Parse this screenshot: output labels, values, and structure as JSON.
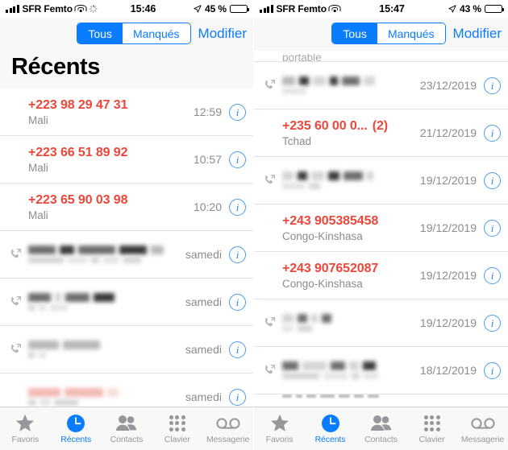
{
  "screens": [
    {
      "status": {
        "carrier": "SFR Femto",
        "time": "15:46",
        "battery_pct": "45 %",
        "signal_icon": "cellular-bars-icon",
        "wifi_icon": "wifi-icon",
        "activity_icon": "activity-spinner-icon",
        "location_icon": "location-arrow-icon",
        "battery_icon": "battery-icon",
        "battery_fill": 45
      },
      "nav": {
        "segments": [
          {
            "label": "Tous",
            "active": true
          },
          {
            "label": "Manqués",
            "active": false
          }
        ],
        "edit_label": "Modifier"
      },
      "title": "Récents",
      "rows": [
        {
          "kind": "text",
          "title": "+223 98 29 47 31",
          "count": "",
          "sub": "Mali",
          "time": "12:59",
          "icon": "",
          "missed": true
        },
        {
          "kind": "text",
          "title": "+223 66 51 89 92",
          "count": "",
          "sub": "Mali",
          "time": "10:57",
          "icon": "",
          "missed": true
        },
        {
          "kind": "text",
          "title": "+223 65 90 03 98",
          "count": "",
          "sub": "Mali",
          "time": "10:20",
          "icon": "",
          "missed": true
        },
        {
          "kind": "redacted",
          "time": "samedi",
          "icon": "outgoing-call-icon",
          "blur_style": "wide"
        },
        {
          "kind": "redacted",
          "time": "samedi",
          "icon": "outgoing-call-icon",
          "blur_style": "medium"
        },
        {
          "kind": "redacted",
          "time": "samedi",
          "icon": "outgoing-call-icon",
          "blur_style": "short"
        },
        {
          "kind": "redacted",
          "time": "samedi",
          "icon": "",
          "blur_style": "pink"
        }
      ]
    },
    {
      "status": {
        "carrier": "SFR Femto",
        "time": "15:47",
        "battery_pct": "43 %",
        "signal_icon": "cellular-bars-icon",
        "wifi_icon": "wifi-icon",
        "activity_icon": "",
        "location_icon": "location-arrow-icon",
        "battery_icon": "battery-icon",
        "battery_fill": 43
      },
      "nav": {
        "segments": [
          {
            "label": "Tous",
            "active": true
          },
          {
            "label": "Manqués",
            "active": false
          }
        ],
        "edit_label": "Modifier"
      },
      "title": "",
      "cut_top_label": "portable",
      "rows": [
        {
          "kind": "redacted",
          "time": "23/12/2019",
          "icon": "outgoing-call-icon",
          "blur_style": "medium"
        },
        {
          "kind": "text",
          "title": "+235 60 00 0...",
          "count": "(2)",
          "sub": "Tchad",
          "time": "21/12/2019",
          "icon": "",
          "missed": true
        },
        {
          "kind": "redacted",
          "time": "19/12/2019",
          "icon": "outgoing-call-icon",
          "blur_style": "medium"
        },
        {
          "kind": "text",
          "title": "+243 905385458",
          "count": "",
          "sub": "Congo-Kinshasa",
          "time": "19/12/2019",
          "icon": "",
          "missed": true
        },
        {
          "kind": "text",
          "title": "+243 907652087",
          "count": "",
          "sub": "Congo-Kinshasa",
          "time": "19/12/2019",
          "icon": "",
          "missed": true
        },
        {
          "kind": "redacted",
          "time": "19/12/2019",
          "icon": "outgoing-call-icon",
          "blur_style": "short"
        },
        {
          "kind": "redacted",
          "time": "18/12/2019",
          "icon": "outgoing-call-icon",
          "blur_style": "wide"
        }
      ]
    }
  ],
  "tabbar": {
    "tabs": [
      {
        "label": "Favoris",
        "icon": "star-icon",
        "active": false
      },
      {
        "label": "Récents",
        "icon": "clock-icon",
        "active": true
      },
      {
        "label": "Contacts",
        "icon": "people-icon",
        "active": false
      },
      {
        "label": "Clavier",
        "icon": "keypad-icon",
        "active": false
      },
      {
        "label": "Messagerie",
        "icon": "voicemail-icon",
        "active": false
      }
    ]
  },
  "info_glyph": "i",
  "colors": {
    "accent_blue": "#0a7cff",
    "missed_red": "#ec473a",
    "secondary_gray": "#8b8b90",
    "bar_bg": "#f8f8f8"
  }
}
